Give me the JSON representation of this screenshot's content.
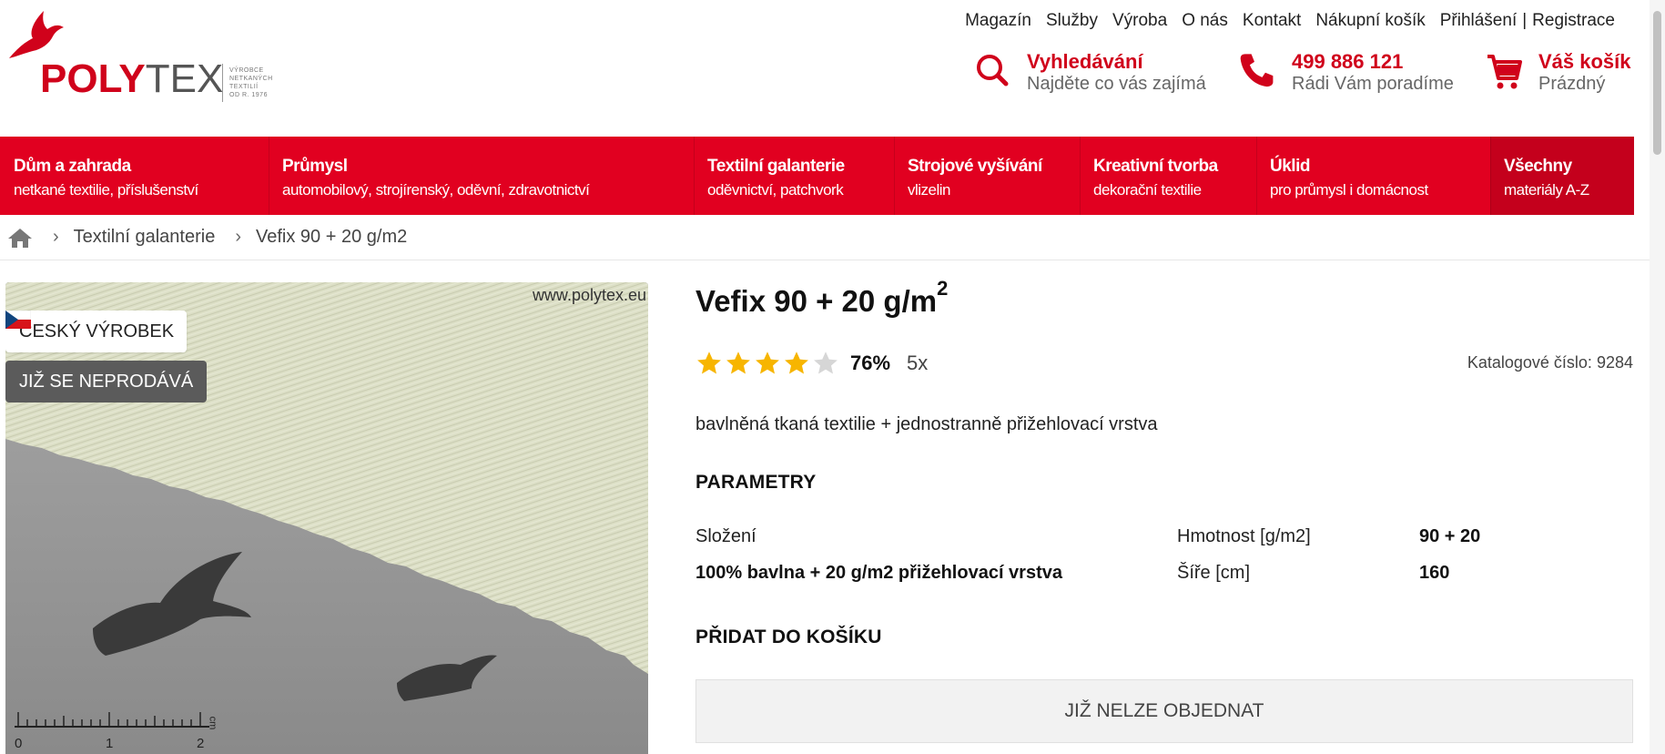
{
  "brand": {
    "logo_primary": "POLY",
    "logo_secondary": "TEX",
    "tagline": [
      "VÝROBCE",
      "NETKANÝCH",
      "TEXTILIÍ",
      "OD R. 1976"
    ],
    "color_primary": "#e10020"
  },
  "topnav": {
    "items": [
      "Magazín",
      "Služby",
      "Výroba",
      "O nás",
      "Kontakt",
      "Nákupní košík",
      "Přihlášení"
    ],
    "register": "Registrace",
    "separator": "|"
  },
  "header_tools": {
    "search": {
      "title": "Vyhledávání",
      "subtitle": "Najděte co vás zajímá",
      "icon": "search-icon"
    },
    "phone": {
      "title": "499 886 121",
      "subtitle": "Rádi Vám poradíme",
      "icon": "phone-icon"
    },
    "cart": {
      "title": "Váš košík",
      "subtitle": "Prázdný",
      "icon": "cart-icon"
    }
  },
  "categories": [
    {
      "title": "Dům a zahrada",
      "subtitle": "netkané textilie, příslušenství"
    },
    {
      "title": "Průmysl",
      "subtitle": "automobilový, strojírenský, oděvní, zdravotnictví"
    },
    {
      "title": "Textilní galanterie",
      "subtitle": "oděvnictví, patchvork"
    },
    {
      "title": "Strojové vyšívání",
      "subtitle": "vlizelin"
    },
    {
      "title": "Kreativní tvorba",
      "subtitle": "dekorační textilie"
    },
    {
      "title": "Úklid",
      "subtitle": "pro průmysl i domácnost"
    },
    {
      "title": "Všechny",
      "subtitle": "materiály A-Z"
    }
  ],
  "breadcrumb": {
    "items": [
      "Textilní galanterie",
      "Vefix 90 + 20 g/m2"
    ]
  },
  "product": {
    "watermark": "www.polytex.eu",
    "badge_origin": "ČESKÝ VÝROBEK",
    "badge_status": "JIŽ SE NEPRODÁVÁ",
    "title_main": "Vefix 90 + 20 g/m",
    "title_sup": "2",
    "rating_percent": "76%",
    "rating_value": 0.76,
    "rating_count": "5x",
    "catalog_label": "Katalogové číslo:",
    "catalog_number": "9284",
    "description": "bavlněná tkaná textilie + jednostranně přižehlovací vrstva",
    "params_title": "PARAMETRY",
    "params": {
      "composition_label": "Složení",
      "composition_value": "100% bavlna + 20 g/m2 přižehlovací vrstva",
      "weight_label": "Hmotnost [g/m2]",
      "weight_value": "90 + 20",
      "width_label": "Šíře [cm]",
      "width_value": "160"
    },
    "cart_title": "PŘIDAT DO KOŠÍKU",
    "cart_button": "JIŽ NELZE OBJEDNAT",
    "ruler_labels": [
      "0",
      "1",
      "2"
    ],
    "ruler_unit": "cm"
  },
  "colors": {
    "accent": "#e10020",
    "accent_dark": "#c4001c",
    "star": "#f7b500",
    "star_empty": "#d6d6d6",
    "badge_dark": "#5b5b5b"
  }
}
